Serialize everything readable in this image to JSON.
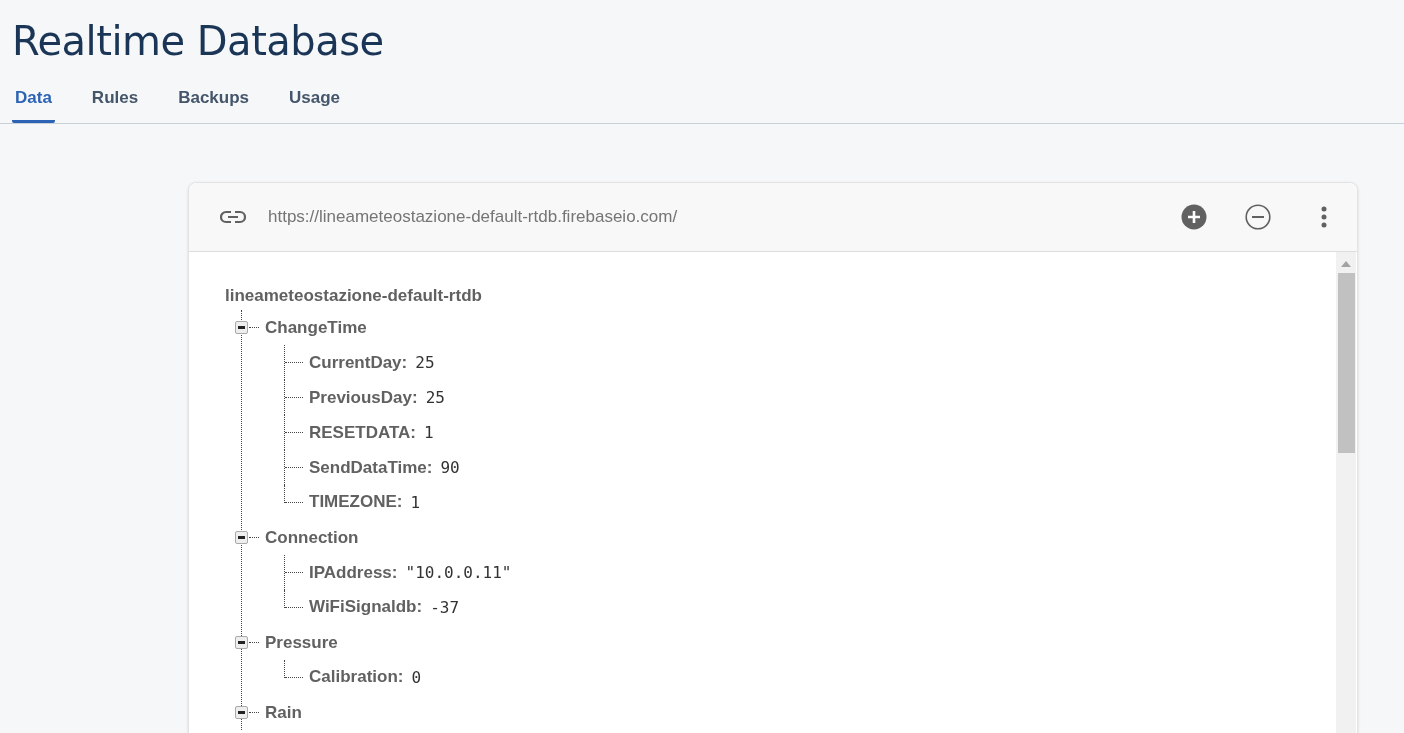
{
  "page": {
    "title": "Realtime Database"
  },
  "tabs": [
    {
      "label": "Data",
      "selected": true
    },
    {
      "label": "Rules",
      "selected": false
    },
    {
      "label": "Backups",
      "selected": false
    },
    {
      "label": "Usage",
      "selected": false
    }
  ],
  "database": {
    "url": "https://lineameteostazione-default-rtdb.firebaseio.com/",
    "root": "lineameteostazione-default-rtdb",
    "nodes": [
      {
        "key": "ChangeTime",
        "expanded": true,
        "children": [
          {
            "key": "CurrentDay:",
            "value": "25"
          },
          {
            "key": "PreviousDay:",
            "value": "25"
          },
          {
            "key": "RESETDATA:",
            "value": "1"
          },
          {
            "key": "SendDataTime:",
            "value": "90"
          },
          {
            "key": "TIMEZONE:",
            "value": "1"
          }
        ]
      },
      {
        "key": "Connection",
        "expanded": true,
        "children": [
          {
            "key": "IPAddress:",
            "value": "\"10.0.0.11\""
          },
          {
            "key": "WiFiSignaldb:",
            "value": "-37"
          }
        ]
      },
      {
        "key": "Pressure",
        "expanded": true,
        "children": [
          {
            "key": "Calibration:",
            "value": "0"
          }
        ]
      },
      {
        "key": "Rain",
        "expanded": true
      }
    ]
  }
}
